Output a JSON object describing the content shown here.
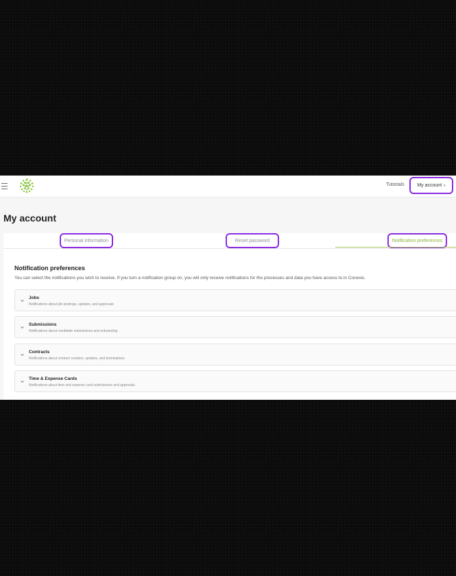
{
  "header": {
    "tutorials_label": "Tutorials",
    "account_label": "My account"
  },
  "page": {
    "title": "My account"
  },
  "tabs": [
    {
      "label": "Personal information"
    },
    {
      "label": "Reset password"
    },
    {
      "label": "Notification preferences",
      "active": true
    }
  ],
  "notifications": {
    "title": "Notification preferences",
    "description": "You can select the notifications you wish to receive. If you turn a notification group on, you will only receive notifications for the processes and data you have access to in Conexis.",
    "groups": [
      {
        "title": "Jobs",
        "subtitle": "Notifications about job postings, updates, and approvals"
      },
      {
        "title": "Submissions",
        "subtitle": "Notifications about candidate submissions and onboarding"
      },
      {
        "title": "Contracts",
        "subtitle": "Notifications about contract creation, updates, and terminations"
      },
      {
        "title": "Time & Expense Cards",
        "subtitle": "Notifications about time and expense card submissions and approvals"
      }
    ]
  },
  "colors": {
    "accent_green": "#8cb33d",
    "highlight_purple": "#8a2be2"
  },
  "icons": [
    "menu-icon",
    "logo-icon",
    "caret-down-icon",
    "chevron-down-icon"
  ]
}
